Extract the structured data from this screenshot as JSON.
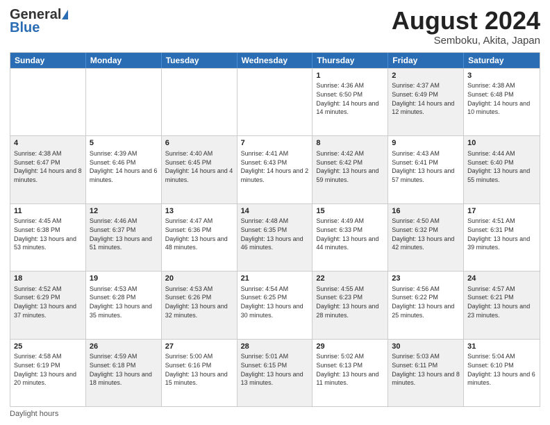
{
  "header": {
    "logo_general": "General",
    "logo_blue": "Blue",
    "month_title": "August 2024",
    "subtitle": "Semboku, Akita, Japan"
  },
  "days_of_week": [
    "Sunday",
    "Monday",
    "Tuesday",
    "Wednesday",
    "Thursday",
    "Friday",
    "Saturday"
  ],
  "footer": {
    "daylight_label": "Daylight hours"
  },
  "weeks": [
    [
      {
        "num": "",
        "sunrise": "",
        "sunset": "",
        "daylight": "",
        "shaded": false
      },
      {
        "num": "",
        "sunrise": "",
        "sunset": "",
        "daylight": "",
        "shaded": false
      },
      {
        "num": "",
        "sunrise": "",
        "sunset": "",
        "daylight": "",
        "shaded": false
      },
      {
        "num": "",
        "sunrise": "",
        "sunset": "",
        "daylight": "",
        "shaded": false
      },
      {
        "num": "1",
        "sunrise": "Sunrise: 4:36 AM",
        "sunset": "Sunset: 6:50 PM",
        "daylight": "Daylight: 14 hours and 14 minutes.",
        "shaded": false
      },
      {
        "num": "2",
        "sunrise": "Sunrise: 4:37 AM",
        "sunset": "Sunset: 6:49 PM",
        "daylight": "Daylight: 14 hours and 12 minutes.",
        "shaded": true
      },
      {
        "num": "3",
        "sunrise": "Sunrise: 4:38 AM",
        "sunset": "Sunset: 6:48 PM",
        "daylight": "Daylight: 14 hours and 10 minutes.",
        "shaded": false
      }
    ],
    [
      {
        "num": "4",
        "sunrise": "Sunrise: 4:38 AM",
        "sunset": "Sunset: 6:47 PM",
        "daylight": "Daylight: 14 hours and 8 minutes.",
        "shaded": true
      },
      {
        "num": "5",
        "sunrise": "Sunrise: 4:39 AM",
        "sunset": "Sunset: 6:46 PM",
        "daylight": "Daylight: 14 hours and 6 minutes.",
        "shaded": false
      },
      {
        "num": "6",
        "sunrise": "Sunrise: 4:40 AM",
        "sunset": "Sunset: 6:45 PM",
        "daylight": "Daylight: 14 hours and 4 minutes.",
        "shaded": true
      },
      {
        "num": "7",
        "sunrise": "Sunrise: 4:41 AM",
        "sunset": "Sunset: 6:43 PM",
        "daylight": "Daylight: 14 hours and 2 minutes.",
        "shaded": false
      },
      {
        "num": "8",
        "sunrise": "Sunrise: 4:42 AM",
        "sunset": "Sunset: 6:42 PM",
        "daylight": "Daylight: 13 hours and 59 minutes.",
        "shaded": true
      },
      {
        "num": "9",
        "sunrise": "Sunrise: 4:43 AM",
        "sunset": "Sunset: 6:41 PM",
        "daylight": "Daylight: 13 hours and 57 minutes.",
        "shaded": false
      },
      {
        "num": "10",
        "sunrise": "Sunrise: 4:44 AM",
        "sunset": "Sunset: 6:40 PM",
        "daylight": "Daylight: 13 hours and 55 minutes.",
        "shaded": true
      }
    ],
    [
      {
        "num": "11",
        "sunrise": "Sunrise: 4:45 AM",
        "sunset": "Sunset: 6:38 PM",
        "daylight": "Daylight: 13 hours and 53 minutes.",
        "shaded": false
      },
      {
        "num": "12",
        "sunrise": "Sunrise: 4:46 AM",
        "sunset": "Sunset: 6:37 PM",
        "daylight": "Daylight: 13 hours and 51 minutes.",
        "shaded": true
      },
      {
        "num": "13",
        "sunrise": "Sunrise: 4:47 AM",
        "sunset": "Sunset: 6:36 PM",
        "daylight": "Daylight: 13 hours and 48 minutes.",
        "shaded": false
      },
      {
        "num": "14",
        "sunrise": "Sunrise: 4:48 AM",
        "sunset": "Sunset: 6:35 PM",
        "daylight": "Daylight: 13 hours and 46 minutes.",
        "shaded": true
      },
      {
        "num": "15",
        "sunrise": "Sunrise: 4:49 AM",
        "sunset": "Sunset: 6:33 PM",
        "daylight": "Daylight: 13 hours and 44 minutes.",
        "shaded": false
      },
      {
        "num": "16",
        "sunrise": "Sunrise: 4:50 AM",
        "sunset": "Sunset: 6:32 PM",
        "daylight": "Daylight: 13 hours and 42 minutes.",
        "shaded": true
      },
      {
        "num": "17",
        "sunrise": "Sunrise: 4:51 AM",
        "sunset": "Sunset: 6:31 PM",
        "daylight": "Daylight: 13 hours and 39 minutes.",
        "shaded": false
      }
    ],
    [
      {
        "num": "18",
        "sunrise": "Sunrise: 4:52 AM",
        "sunset": "Sunset: 6:29 PM",
        "daylight": "Daylight: 13 hours and 37 minutes.",
        "shaded": true
      },
      {
        "num": "19",
        "sunrise": "Sunrise: 4:53 AM",
        "sunset": "Sunset: 6:28 PM",
        "daylight": "Daylight: 13 hours and 35 minutes.",
        "shaded": false
      },
      {
        "num": "20",
        "sunrise": "Sunrise: 4:53 AM",
        "sunset": "Sunset: 6:26 PM",
        "daylight": "Daylight: 13 hours and 32 minutes.",
        "shaded": true
      },
      {
        "num": "21",
        "sunrise": "Sunrise: 4:54 AM",
        "sunset": "Sunset: 6:25 PM",
        "daylight": "Daylight: 13 hours and 30 minutes.",
        "shaded": false
      },
      {
        "num": "22",
        "sunrise": "Sunrise: 4:55 AM",
        "sunset": "Sunset: 6:23 PM",
        "daylight": "Daylight: 13 hours and 28 minutes.",
        "shaded": true
      },
      {
        "num": "23",
        "sunrise": "Sunrise: 4:56 AM",
        "sunset": "Sunset: 6:22 PM",
        "daylight": "Daylight: 13 hours and 25 minutes.",
        "shaded": false
      },
      {
        "num": "24",
        "sunrise": "Sunrise: 4:57 AM",
        "sunset": "Sunset: 6:21 PM",
        "daylight": "Daylight: 13 hours and 23 minutes.",
        "shaded": true
      }
    ],
    [
      {
        "num": "25",
        "sunrise": "Sunrise: 4:58 AM",
        "sunset": "Sunset: 6:19 PM",
        "daylight": "Daylight: 13 hours and 20 minutes.",
        "shaded": false
      },
      {
        "num": "26",
        "sunrise": "Sunrise: 4:59 AM",
        "sunset": "Sunset: 6:18 PM",
        "daylight": "Daylight: 13 hours and 18 minutes.",
        "shaded": true
      },
      {
        "num": "27",
        "sunrise": "Sunrise: 5:00 AM",
        "sunset": "Sunset: 6:16 PM",
        "daylight": "Daylight: 13 hours and 15 minutes.",
        "shaded": false
      },
      {
        "num": "28",
        "sunrise": "Sunrise: 5:01 AM",
        "sunset": "Sunset: 6:15 PM",
        "daylight": "Daylight: 13 hours and 13 minutes.",
        "shaded": true
      },
      {
        "num": "29",
        "sunrise": "Sunrise: 5:02 AM",
        "sunset": "Sunset: 6:13 PM",
        "daylight": "Daylight: 13 hours and 11 minutes.",
        "shaded": false
      },
      {
        "num": "30",
        "sunrise": "Sunrise: 5:03 AM",
        "sunset": "Sunset: 6:11 PM",
        "daylight": "Daylight: 13 hours and 8 minutes.",
        "shaded": true
      },
      {
        "num": "31",
        "sunrise": "Sunrise: 5:04 AM",
        "sunset": "Sunset: 6:10 PM",
        "daylight": "Daylight: 13 hours and 6 minutes.",
        "shaded": false
      }
    ]
  ]
}
